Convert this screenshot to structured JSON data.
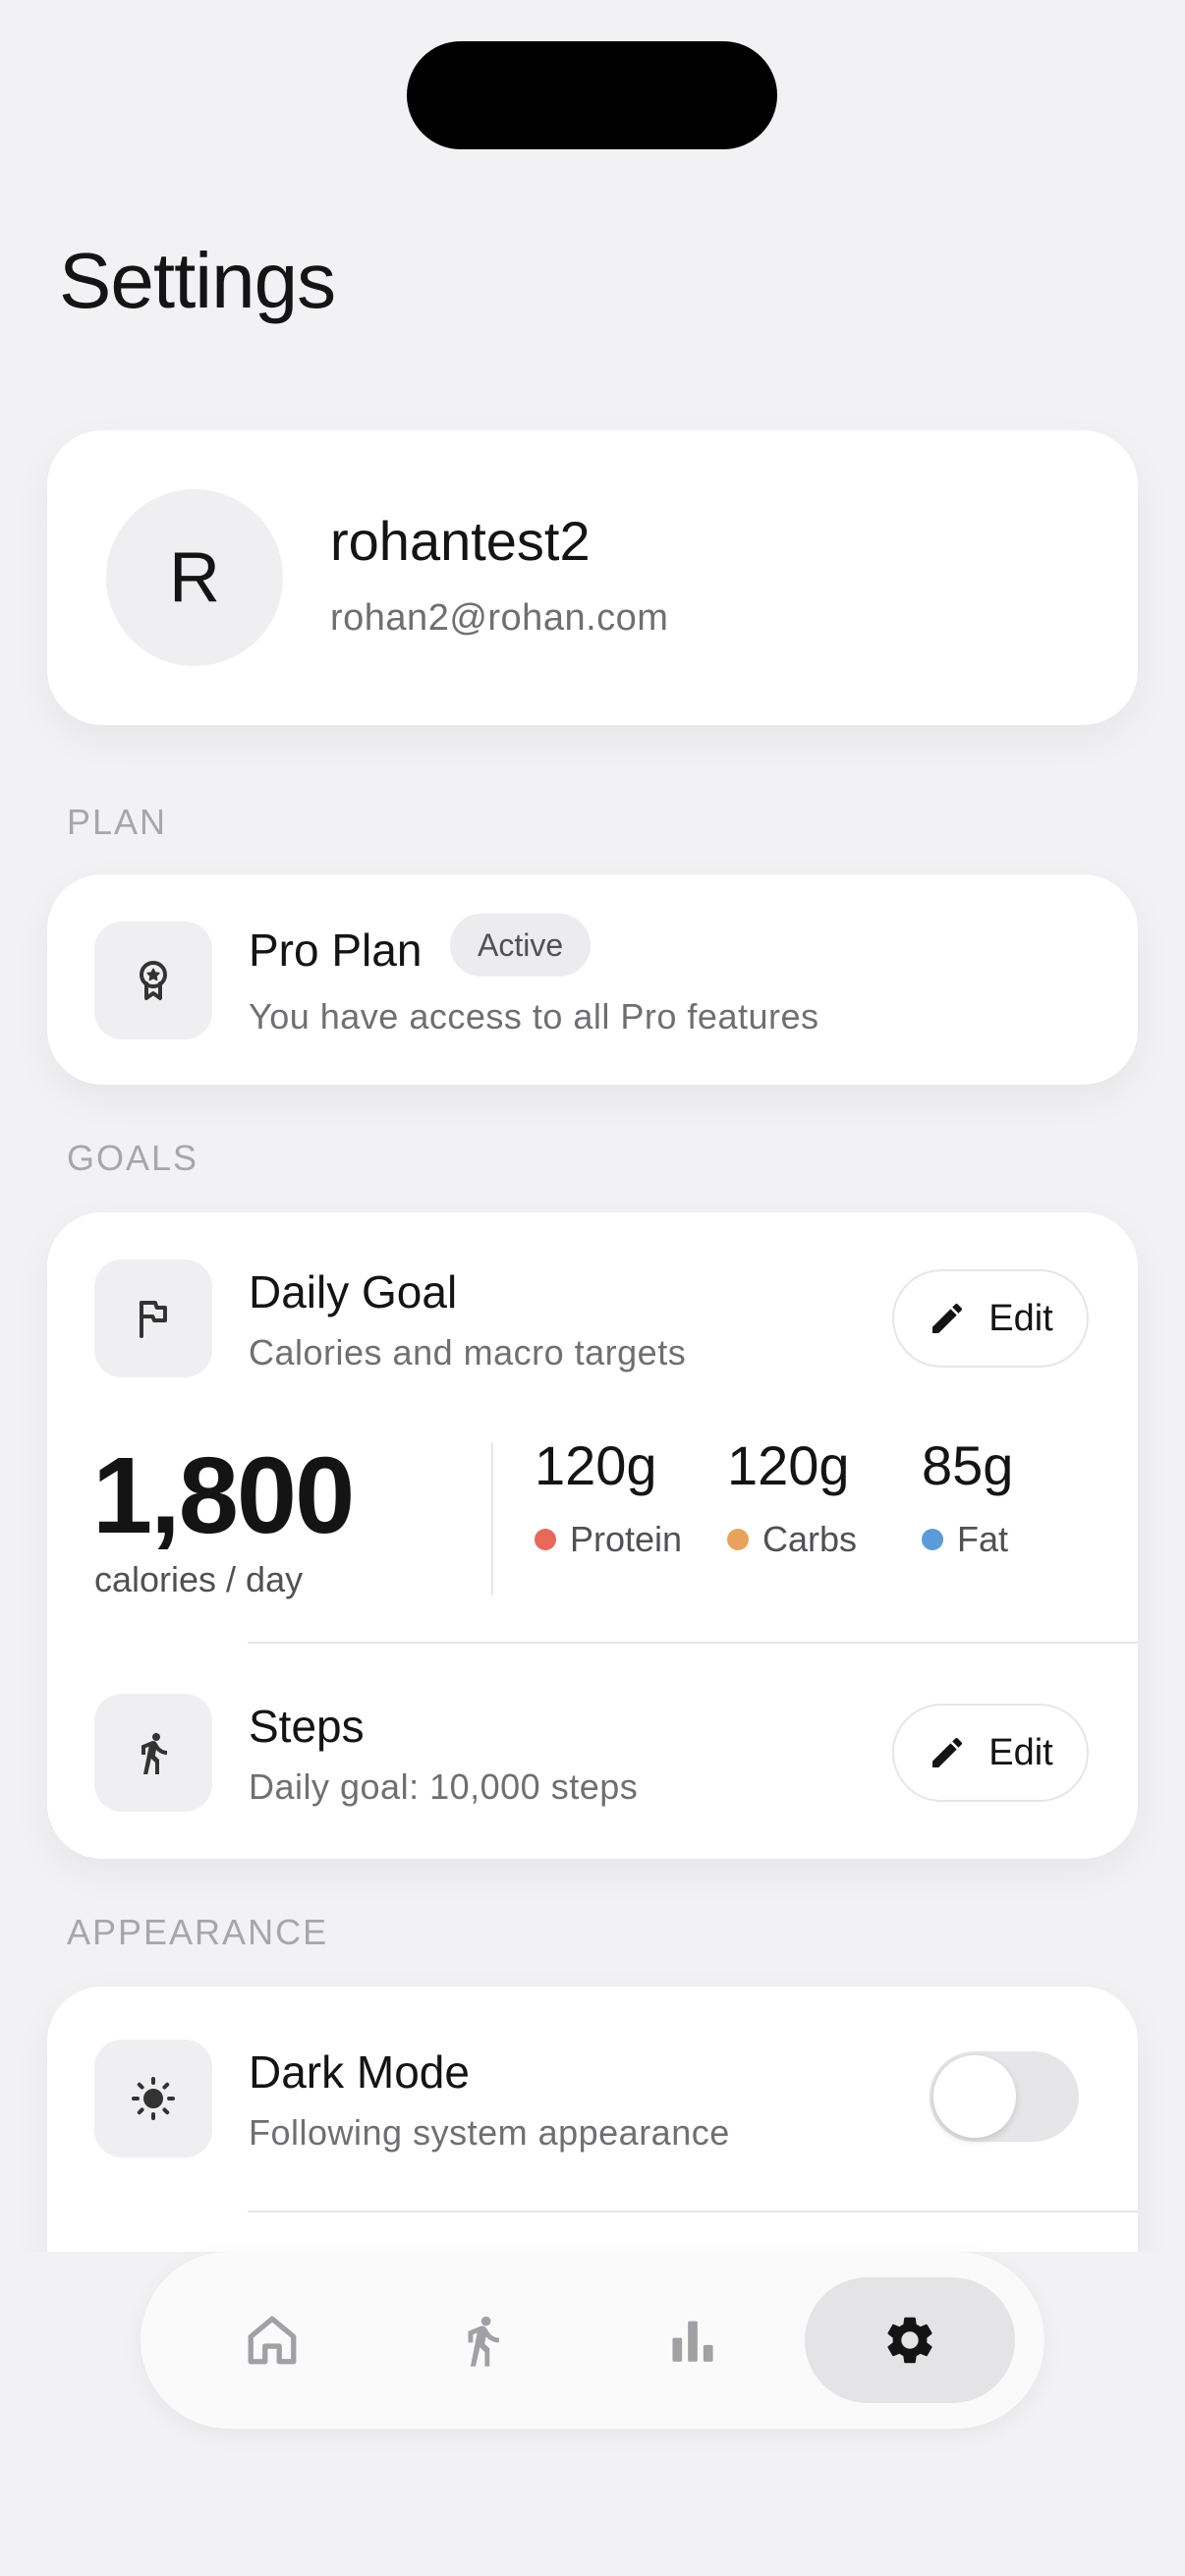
{
  "page": {
    "title": "Settings"
  },
  "profile": {
    "initial": "R",
    "username": "rohantest2",
    "email": "rohan2@rohan.com"
  },
  "sections": {
    "plan": "PLAN",
    "goals": "GOALS",
    "appearance": "APPEARANCE"
  },
  "plan": {
    "icon": "award-icon",
    "title": "Pro Plan",
    "badge": "Active",
    "subtitle": "You have access to all Pro features"
  },
  "goals": {
    "daily": {
      "icon": "flag-icon",
      "title": "Daily Goal",
      "subtitle": "Calories and macro targets",
      "edit_label": "Edit",
      "calories": "1,800",
      "calories_unit": "calories / day",
      "macros": [
        {
          "value": "120g",
          "label": "Protein",
          "color": "#e8695a"
        },
        {
          "value": "120g",
          "label": "Carbs",
          "color": "#e9a25c"
        },
        {
          "value": "85g",
          "label": "Fat",
          "color": "#5b9bd9"
        }
      ]
    },
    "steps": {
      "icon": "walking-icon",
      "title": "Steps",
      "subtitle": "Daily goal: 10,000 steps",
      "edit_label": "Edit"
    }
  },
  "appearance": {
    "dark_mode": {
      "icon": "sun-icon",
      "title": "Dark Mode",
      "subtitle": "Following system appearance",
      "enabled": false
    }
  },
  "nav": {
    "items": [
      {
        "icon": "home-icon",
        "active": false
      },
      {
        "icon": "walking-icon",
        "active": false
      },
      {
        "icon": "bar-chart-icon",
        "active": false
      },
      {
        "icon": "gear-icon",
        "active": true
      }
    ]
  },
  "colors": {
    "background": "#f2f2f4",
    "card": "#ffffff",
    "accent_active": "#e4e4e6"
  }
}
